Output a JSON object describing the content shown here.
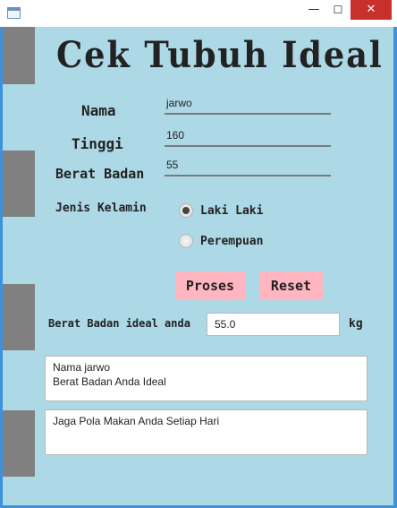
{
  "window": {
    "minimize_glyph": "—",
    "maximize_glyph": "☐",
    "close_glyph": "✕"
  },
  "form": {
    "title": "Cek Tubuh Ideal",
    "nama_label": "Nama",
    "nama_value": "jarwo",
    "tinggi_label": "Tinggi",
    "tinggi_value": "160",
    "berat_label": "Berat Badan",
    "berat_value": "55",
    "kelamin_label": "Jenis Kelamin",
    "radio_male": "Laki Laki",
    "radio_female": "Perempuan",
    "selected_gender": "Laki Laki",
    "proses_label": "Proses",
    "reset_label": "Reset",
    "ideal_label": "Berat Badan ideal anda",
    "ideal_value": "55.0",
    "unit": "kg",
    "result_line1": "Nama jarwo",
    "result_line2": "Berat Badan Anda Ideal",
    "advice": "Jaga Pola Makan Anda Setiap Hari"
  },
  "colors": {
    "background": "#add8e6",
    "button": "#ffb6c1",
    "side_block": "#808080",
    "close": "#c7302b"
  }
}
